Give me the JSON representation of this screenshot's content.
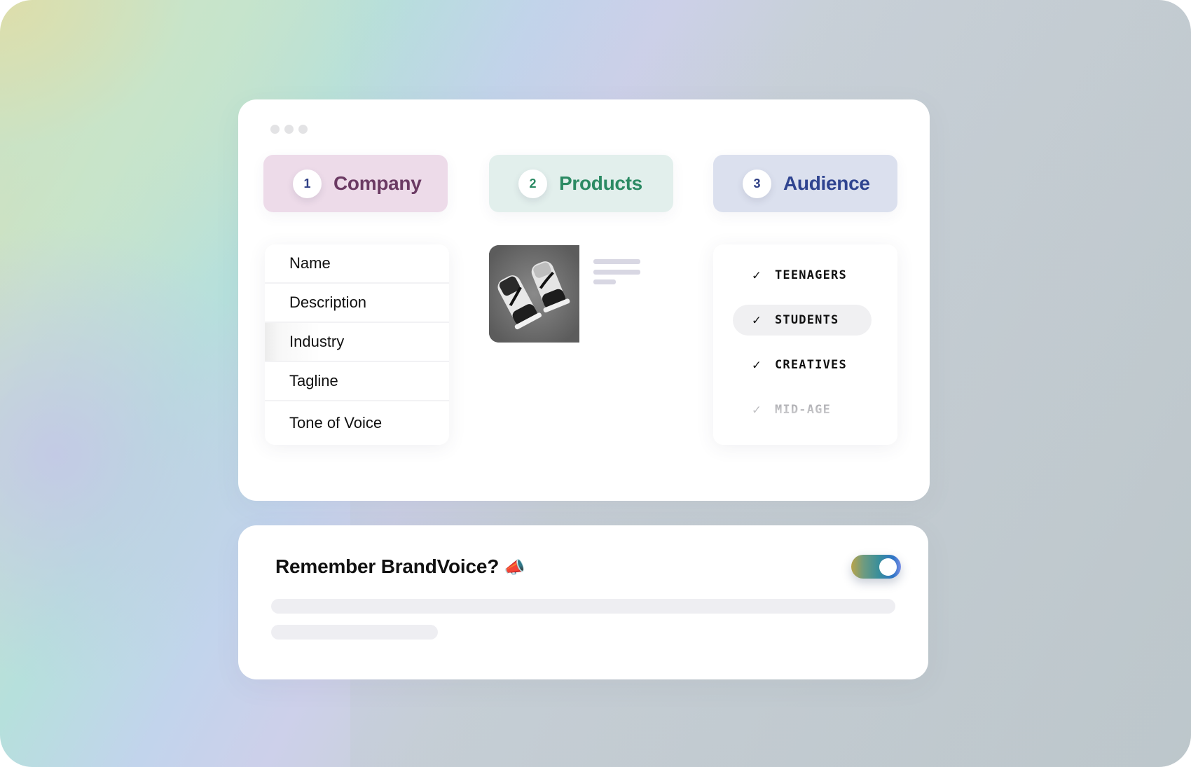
{
  "window": {
    "controls": [
      "dot",
      "dot",
      "dot"
    ]
  },
  "steps": [
    {
      "number": "1",
      "label": "Company",
      "color": "#6b3a63",
      "bg": "#eddbe9"
    },
    {
      "number": "2",
      "label": "Products",
      "color": "#2b8a63",
      "bg": "#e2efec"
    },
    {
      "number": "3",
      "label": "Audience",
      "color": "#2f4490",
      "bg": "#dbe0ee"
    }
  ],
  "company_fields": {
    "items": [
      "Name",
      "Description",
      "Industry",
      "Tagline",
      "Tone of Voice"
    ],
    "active": "Industry"
  },
  "product": {
    "image_icon": "sneakers-photo",
    "description_placeholder_lines": 3
  },
  "audience": {
    "items": [
      {
        "label": "TEENAGERS",
        "checked": true,
        "highlighted": false
      },
      {
        "label": "STUDENTS",
        "checked": true,
        "highlighted": true
      },
      {
        "label": "CREATIVES",
        "checked": true,
        "highlighted": false
      },
      {
        "label": "MID-AGE",
        "checked": true,
        "highlighted": false,
        "faded": true
      }
    ],
    "check_icon": "✓"
  },
  "memory": {
    "title": "Remember BrandVoice?",
    "emoji": "📣",
    "toggle_on": true
  }
}
